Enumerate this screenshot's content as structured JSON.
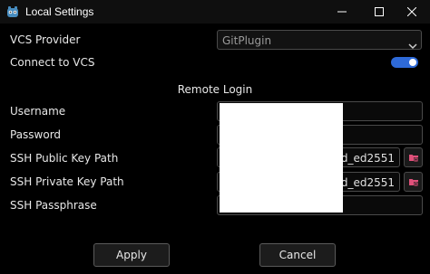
{
  "window": {
    "title": "Local Settings"
  },
  "form": {
    "vcs_provider": {
      "label": "VCS Provider",
      "value": "GitPlugin"
    },
    "connect": {
      "label": "Connect to VCS",
      "enabled": true
    },
    "remote_login_title": "Remote Login",
    "username": {
      "label": "Username",
      "value": ""
    },
    "password": {
      "label": "Password",
      "value": ""
    },
    "ssh_public": {
      "label": "SSH Public Key Path",
      "value": "\\id_ed2551"
    },
    "ssh_private": {
      "label": "SSH Private Key Path",
      "value": "\\id_ed2551"
    },
    "ssh_passphrase": {
      "label": "SSH Passphrase",
      "value": ""
    }
  },
  "footer": {
    "apply_label": "Apply",
    "cancel_label": "Cancel"
  },
  "colors": {
    "accent": "#2e6ad8",
    "browse_icon": "#e0507a"
  }
}
